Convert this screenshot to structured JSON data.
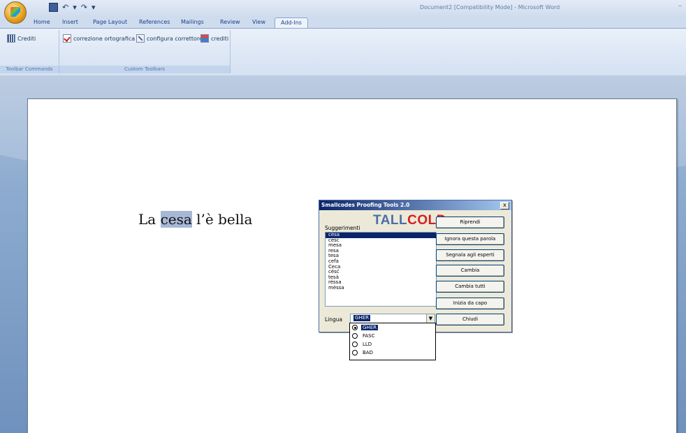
{
  "window": {
    "title": "Document2 [Compatibility Mode] - Microsoft Word",
    "minimize": "–"
  },
  "qat": {
    "undo": "↶",
    "undo_dropdown": "▾",
    "redo": "↷",
    "customize": "▾"
  },
  "tabs": [
    {
      "label": "Home"
    },
    {
      "label": "Insert"
    },
    {
      "label": "Page Layout"
    },
    {
      "label": "References"
    },
    {
      "label": "Mailings"
    },
    {
      "label": "Review"
    },
    {
      "label": "View"
    },
    {
      "label": "Add-Ins",
      "active": true
    }
  ],
  "ribbon": {
    "group1": {
      "label": "Toolbar Commands",
      "button": "Crediti"
    },
    "group2": {
      "label": "Custom Toolbars",
      "buttons": [
        "correzione ortografica",
        "configura correttore",
        "crediti"
      ]
    }
  },
  "document": {
    "before": "La ",
    "highlight": "cesa",
    "after": " l’è bella"
  },
  "dialog": {
    "title": "Smallcodes Proofing Tools 2.0",
    "close": "x",
    "suggestions_label": "Suggerimenti",
    "brand_part1": "TALL",
    "brand_part2": "COLD",
    "suggestions": [
      "césa",
      "cesc",
      "mesa",
      "resa",
      "tesa",
      "cefa",
      "Ceca",
      "césć",
      "tesà",
      "réssa",
      "mèssa"
    ],
    "selected_index": 0,
    "lingua_label": "Lingua",
    "lingua_value": "GHER",
    "dropdown_arrow": "▼",
    "buttons": [
      "Riprendi",
      "Ignora questa parola",
      "Segnala agli esperti",
      "Cambia",
      "Cambia tutti",
      "Inizia da capo",
      "Chiudi"
    ],
    "lingua_options": [
      "GHER",
      "FASC",
      "LLD",
      "BAD"
    ]
  },
  "colors": {
    "accent": "#0a246a",
    "brand_blue": "#4a6ea9",
    "brand_red": "#d42020"
  }
}
